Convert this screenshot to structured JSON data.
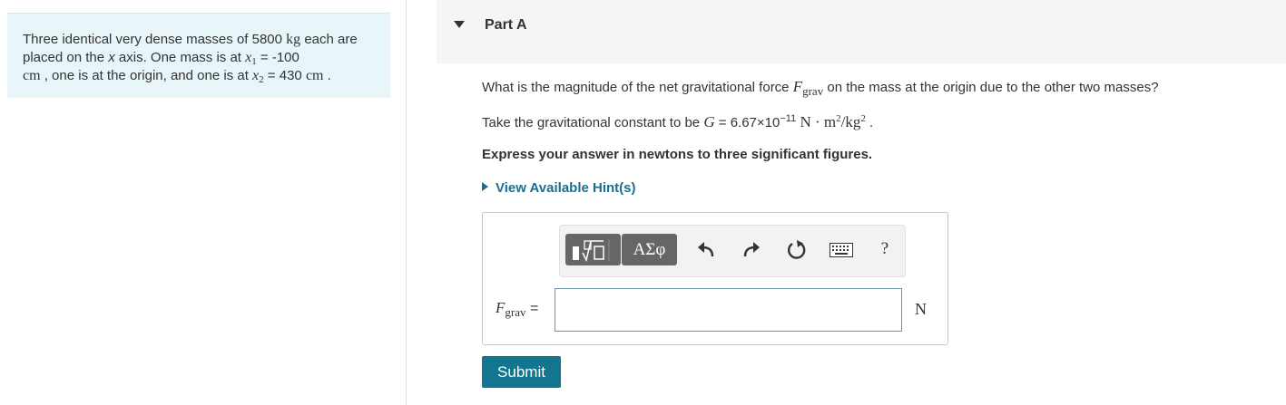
{
  "problem": {
    "seg1": "Three identical very dense masses of 5800 ",
    "unit_kg": "kg",
    "seg2": " each are placed on the ",
    "x_var": "x",
    "seg3": " axis. One mass is at ",
    "x1_var": "x",
    "x1_sub": "1",
    "x1_value": " = -100",
    "unit_cm1": "cm",
    "seg4": " , one is at the origin, and one is at ",
    "x2_var": "x",
    "x2_sub": "2",
    "x2_value": " = 430 ",
    "unit_cm2": "cm",
    "end": " ."
  },
  "part": {
    "title": "Part A"
  },
  "question": {
    "pre": "What is the magnitude of the net gravitational force ",
    "F": "F",
    "F_sub": "grav",
    "post": " on the mass at the origin due to the other two masses?"
  },
  "given": {
    "pre": "Take the gravitational constant to be ",
    "G": "G",
    "eq": " = 6.67×10",
    "exp": "−11",
    "unit_N": " N",
    "dot": " · ",
    "unit_m": "m",
    "m_exp": "2",
    "slash": "/",
    "unit_kg": "kg",
    "kg_exp": "2",
    "end": " ."
  },
  "instruction": "Express your answer in newtons to three significant figures.",
  "hints": {
    "label": "View Available Hint(s)"
  },
  "toolbar": {
    "symbols_label": "ΑΣφ",
    "help_label": "?",
    "icons": [
      "templates-icon",
      "undo-icon",
      "redo-icon",
      "reset-icon",
      "keyboard-icon"
    ]
  },
  "answer": {
    "label_F": "F",
    "label_sub": "grav",
    "equals": " =",
    "value": "",
    "unit": "N"
  },
  "submit_label": "Submit",
  "colors": {
    "accent": "#127691",
    "link": "#1a6e91",
    "problem_bg": "#e9f6f9",
    "header_bg": "#f5f5f5",
    "toolbar_button": "#666666"
  }
}
